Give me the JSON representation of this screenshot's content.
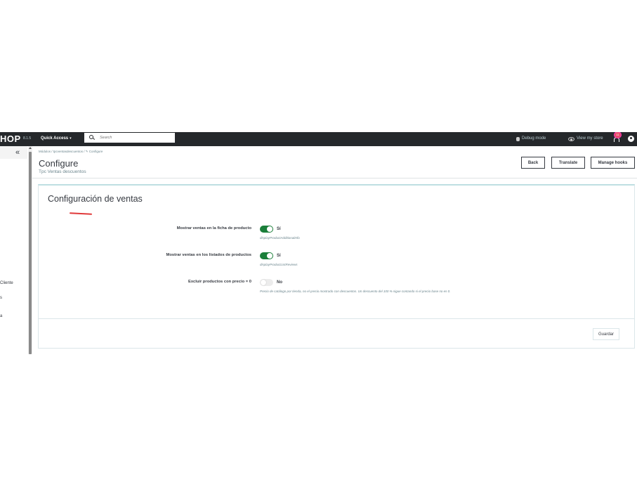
{
  "topbar": {
    "logo": "HOP",
    "version": "8.1.5",
    "quick_access": "Quick Access",
    "quick_access_caret": "▾",
    "search_placeholder": "Search",
    "debug_mode": "Debug mode",
    "view_store": "View my store",
    "notification_count": "11"
  },
  "sidebar": {
    "collapse_glyph": "«",
    "items": [
      {
        "label": "Cliente"
      },
      {
        "label": "s"
      },
      {
        "label": "a"
      }
    ]
  },
  "header": {
    "breadcrumb": "Módulos / tpcventasdescuentos / ✎ Configure",
    "title": "Configure",
    "subtitle": "Tpc Ventas descuentos",
    "buttons": {
      "back": "Back",
      "translate": "Translate",
      "manage_hooks": "Manage hooks"
    }
  },
  "panel": {
    "title": "Configuración de ventas",
    "rows": [
      {
        "label": "Mostrar ventas en la ficha de producto",
        "state": "Sí",
        "enabled": true,
        "help": "displayProductAdditionalInfo"
      },
      {
        "label": "Mostrar ventas en los listados de productos",
        "state": "Sí",
        "enabled": true,
        "help": "displayProductListReviews"
      },
      {
        "label": "Excluir productos con precio = 0",
        "state": "No",
        "enabled": false,
        "help": "Precio de catálogo por tienda, no el precio mostrado con descuentos. Un descuento del 100 % sigue contando si el precio base no es 0."
      }
    ],
    "save_label": "Guardar"
  },
  "colors": {
    "topbar_bg": "#25282b",
    "toggle_on": "#1b7f3a",
    "annotation_red": "#e0393a"
  }
}
